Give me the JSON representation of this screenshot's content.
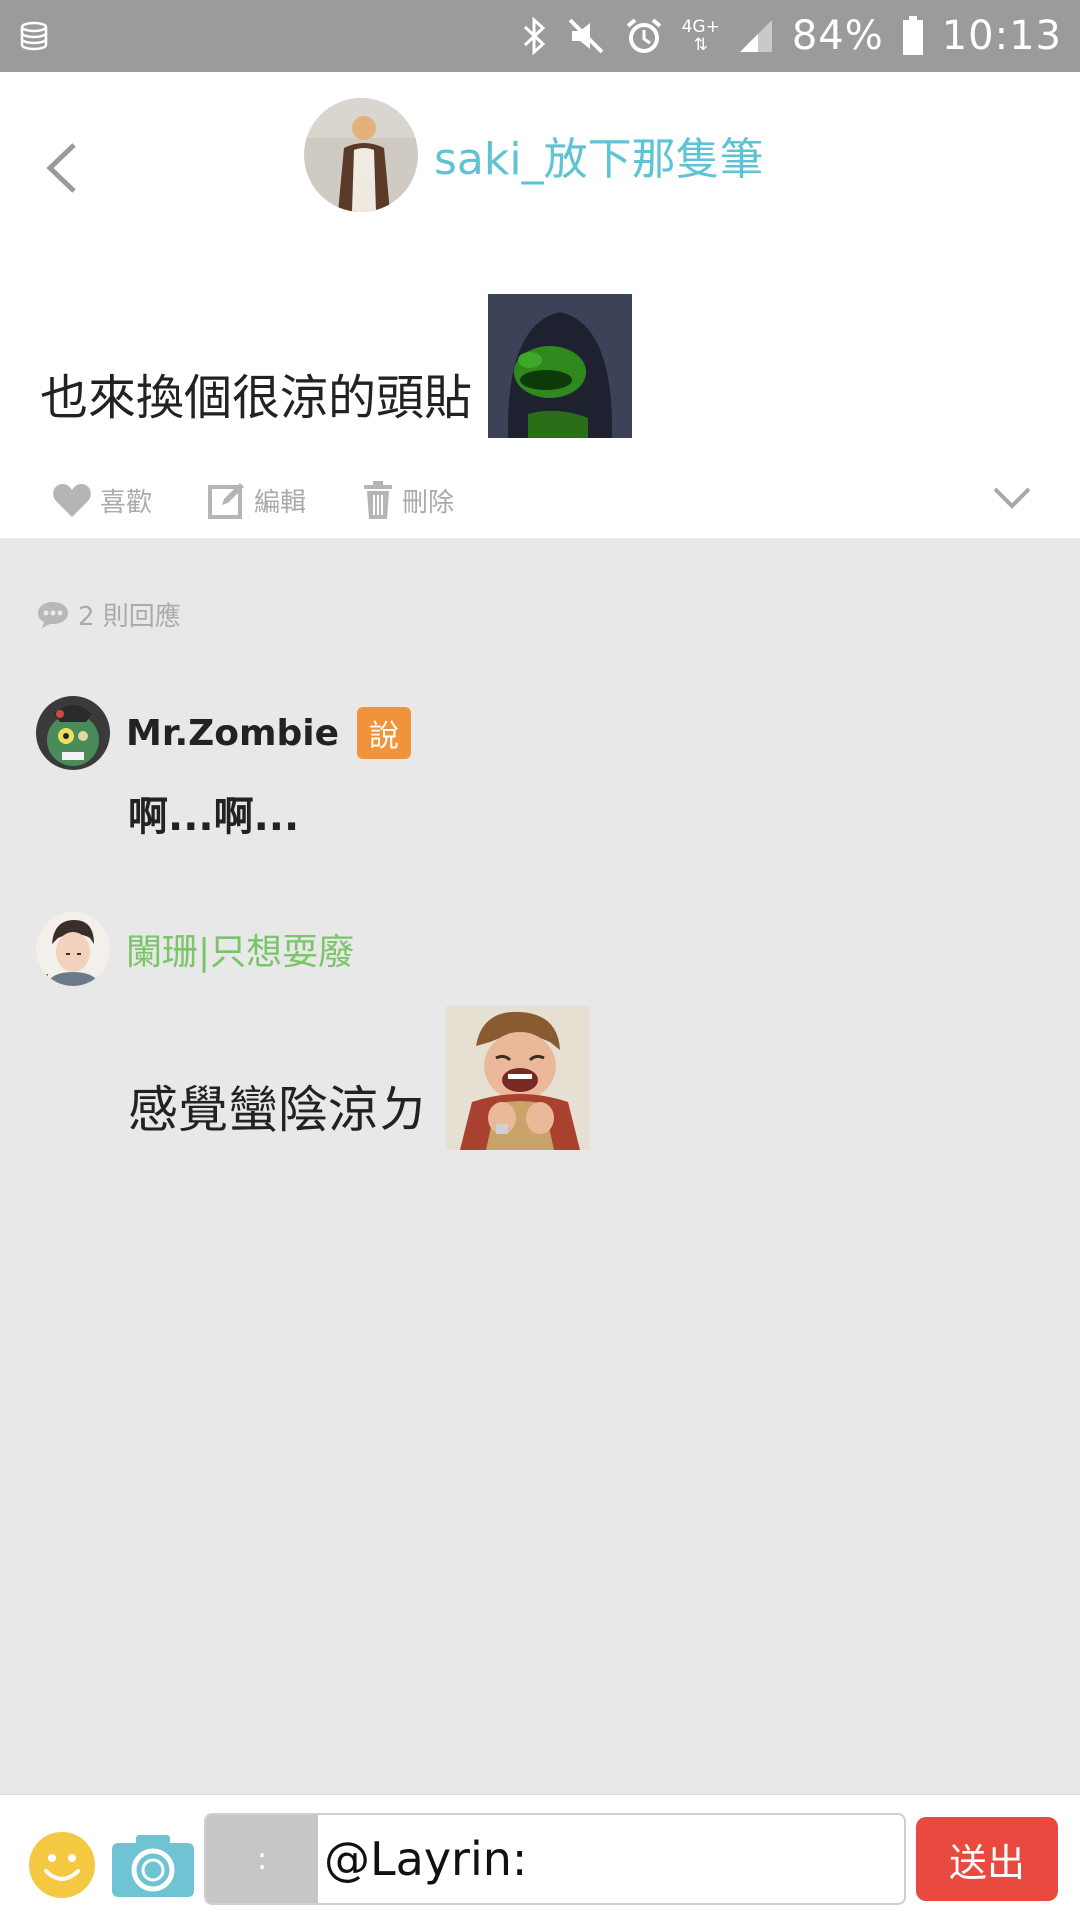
{
  "status_bar": {
    "network": "4G+",
    "battery": "84%",
    "time": "10:13"
  },
  "post": {
    "author": "saki_放下那隻筆",
    "text": "也來換個很涼的頭貼",
    "actions": {
      "like": "喜歡",
      "edit": "編輯",
      "delete": "刪除"
    }
  },
  "comments": {
    "count_label": "2 則回應",
    "items": [
      {
        "name": "Mr.Zombie",
        "badge": "說",
        "text": "啊...啊..."
      },
      {
        "name": "闌珊|只想耍廢",
        "text": "感覺蠻陰涼ㄉ"
      }
    ]
  },
  "input": {
    "prefix": ":",
    "value": "@Layrin:",
    "send_label": "送出"
  },
  "colors": {
    "accent_teal": "#5ec3d4",
    "badge_orange": "#f0933b",
    "green_name": "#7ac46a",
    "send_red": "#e84a3f"
  }
}
